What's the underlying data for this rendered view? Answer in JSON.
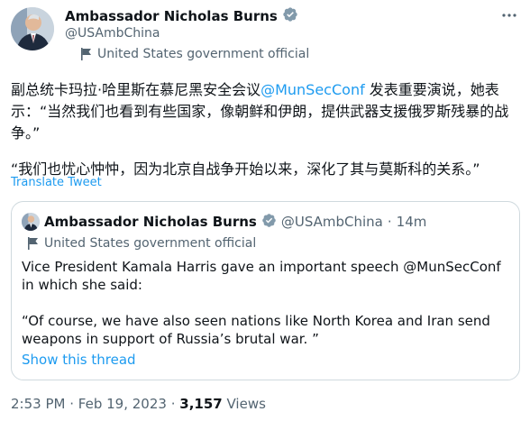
{
  "author": {
    "name": "Ambassador Nicholas Burns",
    "handle": "@USAmbChina",
    "affiliation": "United States government official",
    "verified_badge_color": "#829aab"
  },
  "more_icon": "more-dots-icon",
  "tweet": {
    "line1_pre": "副总统卡玛拉·哈里斯在慕尼黑安全会议",
    "mention": "@MunSecConf",
    "line1_post": " 发表重要演说，她表示：“当然我们也看到有些国家，像朝鲜和伊朗，提供武器支援俄罗斯残暴的战争。”",
    "paragraph2": "“我们也忧心忡忡，因为北京自战争开始以来，深化了其与莫斯科的关系。”",
    "translate_label": "Translate Tweet"
  },
  "quote": {
    "name": "Ambassador Nicholas Burns",
    "handle": "@USAmbChina",
    "separator": "·",
    "time": "14m",
    "affiliation": "United States government official",
    "paragraph1": "Vice President Kamala Harris gave an important speech @MunSecConf in which she said:",
    "paragraph2": "“Of course, we have also seen nations like North Korea and Iran send weapons in support of Russia’s brutal war. ”",
    "show_thread": "Show this thread"
  },
  "footer": {
    "time": "2:53 PM",
    "date": "Feb 19, 2023",
    "separator": "·",
    "views_count": "3,157",
    "views_label": "Views"
  },
  "colors": {
    "link": "#1d9bf0",
    "secondary_text": "#536471",
    "primary_text": "#0f1419",
    "border": "#cfd9de"
  }
}
